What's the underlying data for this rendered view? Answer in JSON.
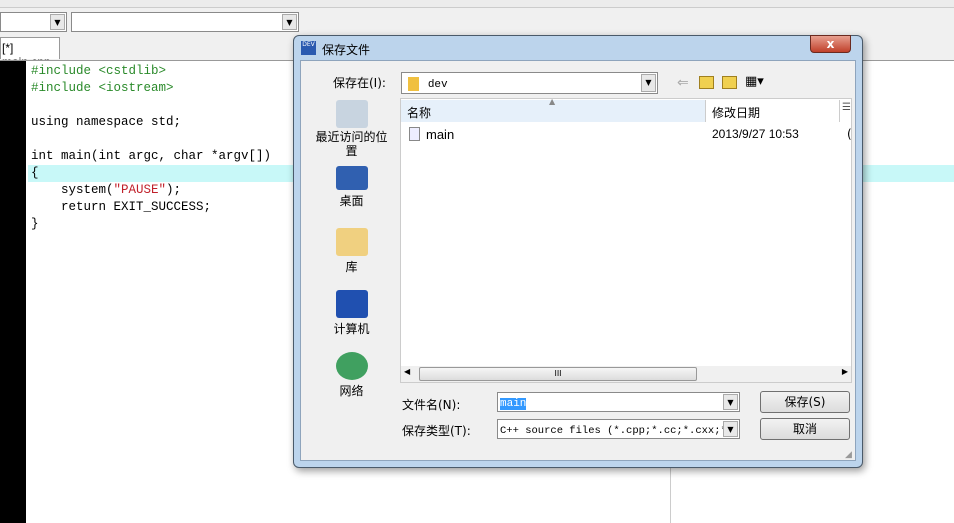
{
  "ide": {
    "tab": "[*] main.cpp",
    "code": [
      {
        "kind": "pp",
        "text": "#include <cstdlib>"
      },
      {
        "kind": "pp",
        "text": "#include <iostream>"
      },
      {
        "kind": "plain",
        "text": ""
      },
      {
        "kind": "plain",
        "text": "using namespace std;"
      },
      {
        "kind": "plain",
        "text": ""
      },
      {
        "kind": "plain",
        "text": "int main(int argc, char *argv[])"
      },
      {
        "kind": "plain",
        "text": "{"
      },
      {
        "kind": "plain",
        "text": "    system("
      },
      {
        "kind": "plain",
        "text": "    return EXIT_SUCCESS;"
      },
      {
        "kind": "plain",
        "text": "}"
      }
    ],
    "system_arg": "\"PAUSE\"",
    "system_tail": ");"
  },
  "dialog": {
    "title": "保存文件",
    "close": "x",
    "save_in_label": "保存在(I):",
    "save_in_value": "dev",
    "places": [
      "最近访问的位置",
      "桌面",
      "库",
      "计算机",
      "网络"
    ],
    "columns": [
      "名称",
      "修改日期",
      "☰"
    ],
    "files": [
      {
        "name": "main",
        "date": "2013/9/27 10:53",
        "extra": "("
      }
    ],
    "filename_label": "文件名(N):",
    "filename_value": "main",
    "type_label": "保存类型(T):",
    "type_value": "C++ source files (*.cpp;*.cc;*.cxx;*.",
    "save_button": "保存(S)",
    "cancel_button": "取消"
  },
  "colors": {
    "highlight_line": "#c8f8f8",
    "selection": "#3399ff"
  }
}
